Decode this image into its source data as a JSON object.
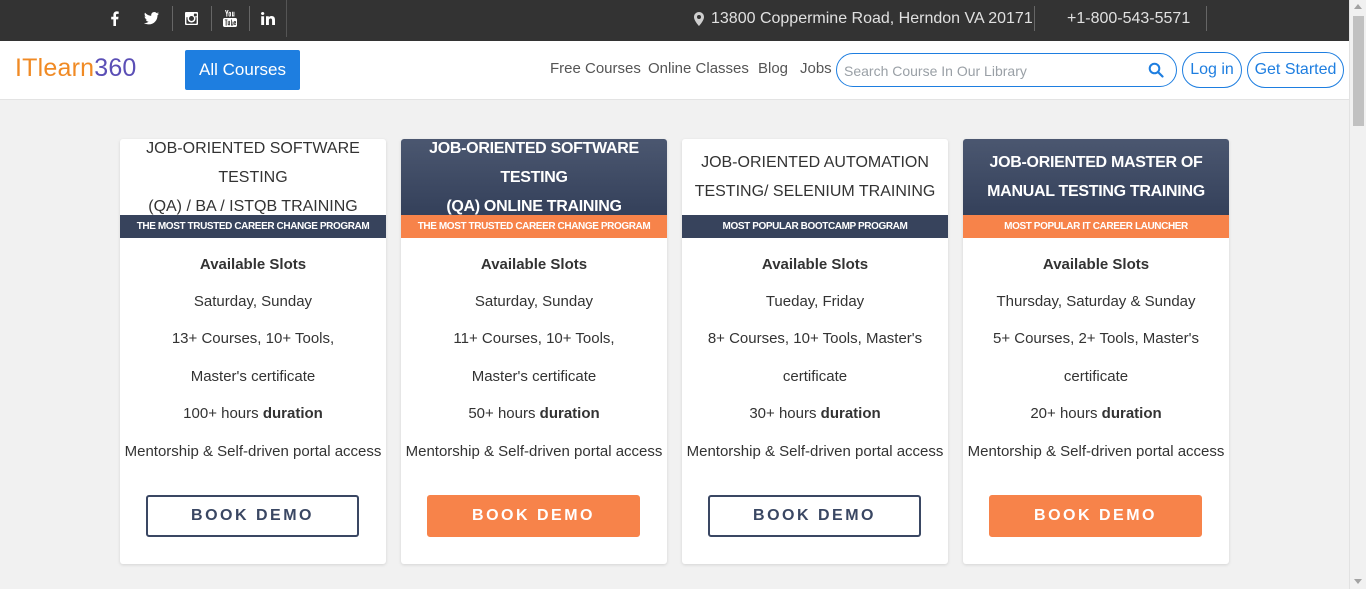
{
  "topbar": {
    "social": [
      {
        "icon": "facebook-icon"
      },
      {
        "icon": "twitter-icon"
      },
      {
        "icon": "instagram-icon"
      },
      {
        "icon": "youtube-icon"
      },
      {
        "icon": "linkedin-icon"
      }
    ],
    "address": "13800 Coppermine Road, Herndon VA 20171",
    "phone": "+1-800-543-5571"
  },
  "header": {
    "logo_it": "ITlearn",
    "logo_num": "360",
    "all_courses": "All Courses",
    "nav": [
      "Free Courses",
      "Online Classes",
      "Blog",
      "Jobs"
    ],
    "search_placeholder": "Search Course In Our Library",
    "login": "Log in",
    "get_started": "Get Started"
  },
  "cards": [
    {
      "title_line1": "JOB-ORIENTED SOFTWARE TESTING",
      "title_line2": "(QA) / BA / ISTQB TRAINING",
      "ribbon": "THE MOST TRUSTED CAREER CHANGE PROGRAM",
      "slots_label": "Available Slots",
      "days": "Saturday, Sunday",
      "courses": "13+ Courses, 10+ Tools, Master's certificate",
      "hours": "100+ hours",
      "duration": "duration",
      "mentorship": "Mentorship & Self-driven portal access",
      "button": "BOOK DEMO"
    },
    {
      "title_line1": "JOB-ORIENTED SOFTWARE TESTING",
      "title_line2": "(QA) ONLINE TRAINING",
      "ribbon": "THE MOST TRUSTED CAREER CHANGE PROGRAM",
      "slots_label": "Available Slots",
      "days": "Saturday, Sunday",
      "courses": "11+ Courses, 10+ Tools, Master's certificate",
      "hours": "50+ hours",
      "duration": "duration",
      "mentorship": "Mentorship & Self-driven portal access",
      "button": "BOOK DEMO"
    },
    {
      "title_line1": "JOB-ORIENTED AUTOMATION",
      "title_line2": "TESTING/ SELENIUM TRAINING",
      "ribbon": "MOST POPULAR BOOTCAMP PROGRAM",
      "slots_label": "Available Slots",
      "days": "Tueday, Friday",
      "courses": "8+ Courses, 10+ Tools, Master's certificate",
      "hours": "30+ hours",
      "duration": "duration",
      "mentorship": "Mentorship & Self-driven portal access",
      "button": "BOOK DEMO"
    },
    {
      "title_line1": "JOB-ORIENTED MASTER OF",
      "title_line2": "MANUAL TESTING TRAINING",
      "ribbon": "MOST POPULAR IT CAREER LAUNCHER",
      "slots_label": "Available Slots",
      "days": "Thursday, Saturday & Sunday",
      "courses": "5+ Courses, 2+ Tools, Master's certificate",
      "hours": "20+ hours",
      "duration": "duration",
      "mentorship": "Mentorship & Self-driven portal access",
      "button": "BOOK DEMO"
    }
  ],
  "colors": {
    "topbar": "#333333",
    "primary_blue": "#1e7ee0",
    "navy": "#37435c",
    "orange": "#f7834a",
    "logo_orange": "#f08a24",
    "logo_purple": "#5b4fb6"
  }
}
